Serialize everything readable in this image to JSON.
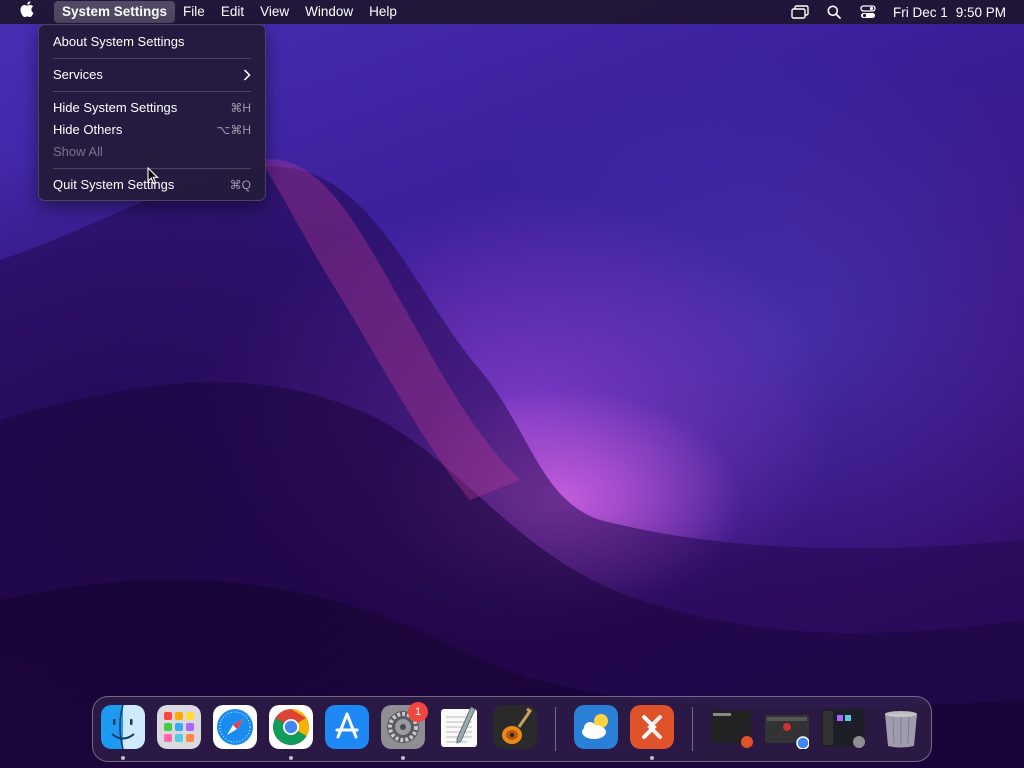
{
  "menubar": {
    "app_name": "System Settings",
    "items": [
      "File",
      "Edit",
      "View",
      "Window",
      "Help"
    ],
    "clock": {
      "day": "Fri Dec 1",
      "time": "9:50 PM"
    },
    "status_icons": [
      "screen-mirroring-icon",
      "search-icon",
      "control-center-icon"
    ]
  },
  "app_menu": {
    "about": "About System Settings",
    "services": "Services",
    "hide": {
      "label": "Hide System Settings",
      "shortcut": "⌘H"
    },
    "hide_others": {
      "label": "Hide Others",
      "shortcut": "⌥⌘H"
    },
    "show_all": "Show All",
    "quit": {
      "label": "Quit System Settings",
      "shortcut": "⌘Q"
    }
  },
  "dock": {
    "apps": [
      "Finder",
      "Launchpad",
      "Safari",
      "Google Chrome",
      "App Store",
      "System Settings",
      "TextEdit",
      "GarageBand",
      "Weather",
      "Microsoft Remote Desktop",
      "Window preview 1",
      "Window preview 2",
      "Window preview 3",
      "Trash"
    ],
    "settings_badge": "1"
  },
  "colors": {
    "menubar_bg": "#1e1630",
    "menu_bg": "#241a3a",
    "badge": "#f2453d",
    "wallpaper_accent": "#d666e6"
  }
}
